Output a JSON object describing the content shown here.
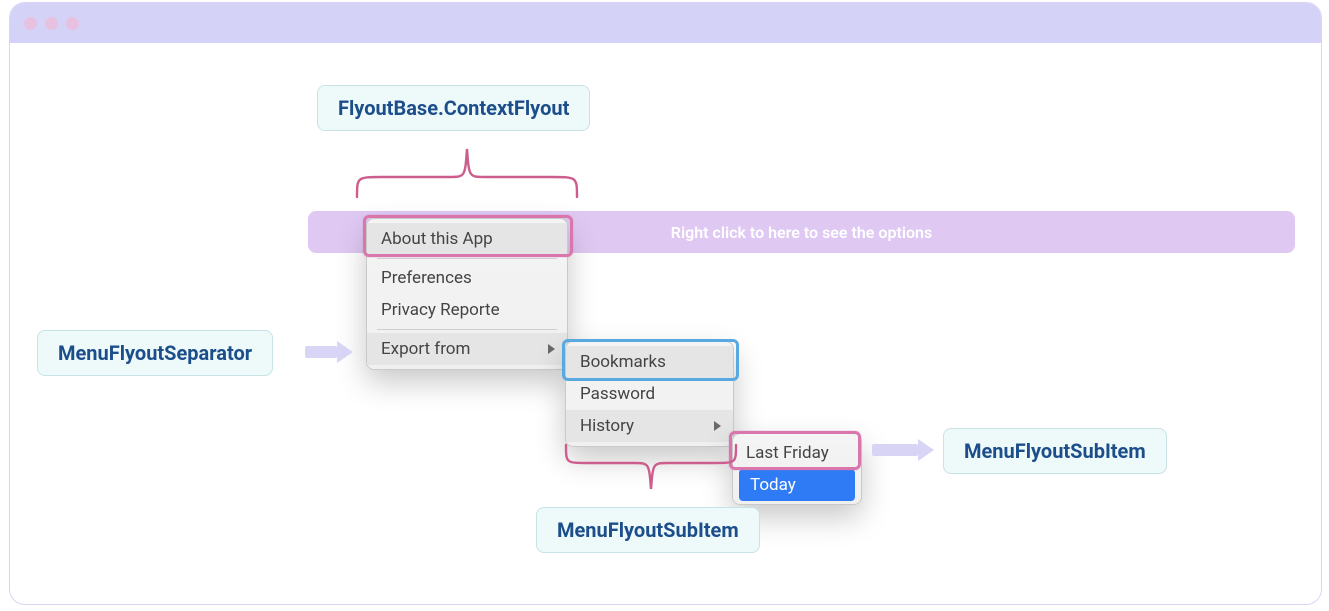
{
  "hint_text": "Right click to here to see the options",
  "tags": {
    "context_flyout": "FlyoutBase.ContextFlyout",
    "separator": "MenuFlyoutSeparator",
    "subitem_bottom": "MenuFlyoutSubItem",
    "subitem_right": "MenuFlyoutSubItem"
  },
  "menus": {
    "m1": {
      "about": "About this App",
      "preferences": "Preferences",
      "privacy": "Privacy Reporte",
      "export": "Export from"
    },
    "m2": {
      "bookmarks": "Bookmarks",
      "password": "Password",
      "history": "History"
    },
    "m3": {
      "last_friday": "Last Friday",
      "today": "Today"
    }
  }
}
